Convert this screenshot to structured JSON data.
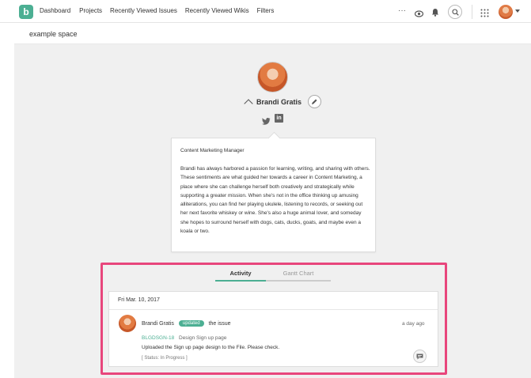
{
  "topbar": {
    "logo": "b",
    "nav": [
      "Dashboard",
      "Projects",
      "Recently Viewed Issues",
      "Recently Viewed Wikis",
      "Filters"
    ],
    "more": "···",
    "accent": "#4caf93"
  },
  "space": {
    "name": "example space"
  },
  "profile": {
    "name": "Brandi Gratis",
    "linkedin_label": "in",
    "job_title": "Content Marketing Manager",
    "bio": "Brandi has always harbored a passion for learning, writing, and sharing with others. These sentiments are what guided her towards a career in Content Marketing, a place where she can challenge herself both creatively and strategically while supporting a greater mission. When she's not in the office thinking up amusing alliterations, you can find her playing ukulele, listening to records, or seeking out her next favorite whiskey or wine. She's also a huge animal lover, and someday she hopes to surround herself with dogs, cats, ducks, goats, and maybe even a koala or two."
  },
  "tabs": [
    {
      "label": "Activity",
      "active": true
    },
    {
      "label": "Gantt Chart",
      "active": false
    }
  ],
  "activity": {
    "date": "Fri Mar. 10, 2017",
    "user": "Brandi Gratis",
    "action_badge": "updated",
    "action_text": "the issue",
    "time_ago": "a day ago",
    "issue_key": "BLGDSGN-18",
    "issue_title": "Design Sign up page",
    "comment": "Uploaded the Sign up page design to the File. Please check.",
    "status": "[ Status: In Progress ]"
  },
  "highlight_color": "#e8467c"
}
